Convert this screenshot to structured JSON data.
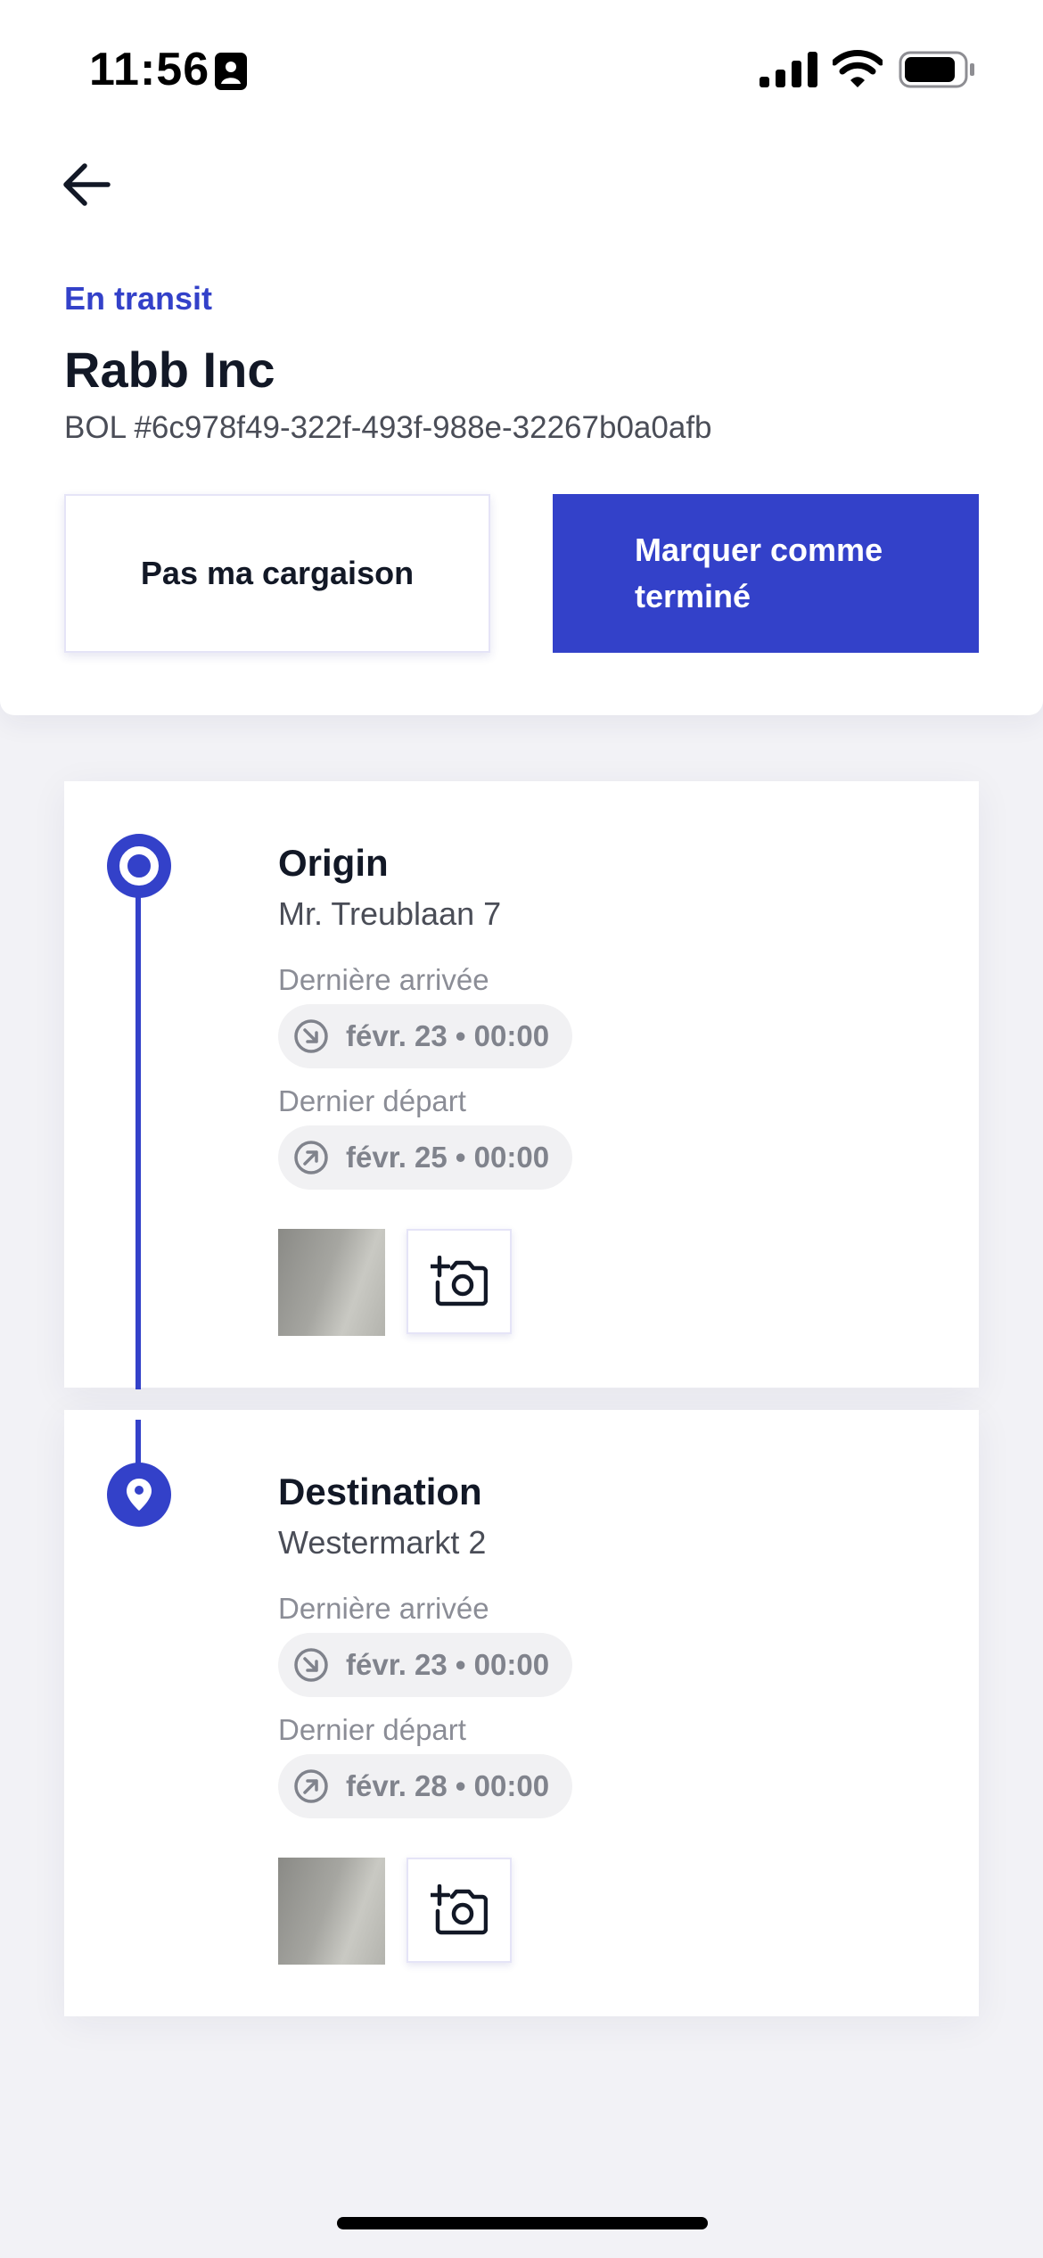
{
  "status_bar": {
    "time": "11:56"
  },
  "shipment": {
    "status": "En transit",
    "company": "Rabb Inc",
    "bol": "BOL #6c978f49-322f-493f-988e-32267b0a0afb"
  },
  "actions": {
    "not_my_cargo": "Pas ma cargaison",
    "mark_done": "Marquer comme terminé"
  },
  "stops": [
    {
      "title": "Origin",
      "address": "Mr. Treublaan 7",
      "arrival_label": "Dernière arrivée",
      "arrival_value": "févr. 23 • 00:00",
      "departure_label": "Dernier départ",
      "departure_value": "févr. 25 • 00:00",
      "marker_icon": "origin-ring-icon"
    },
    {
      "title": "Destination",
      "address": "Westermarkt 2",
      "arrival_label": "Dernière arrivée",
      "arrival_value": "févr. 23 • 00:00",
      "departure_label": "Dernier départ",
      "departure_value": "févr. 28 • 00:00",
      "marker_icon": "location-pin-icon"
    }
  ],
  "colors": {
    "accent": "#3341c9",
    "background": "#f2f2f6",
    "pill_background": "#f1f1f3"
  }
}
